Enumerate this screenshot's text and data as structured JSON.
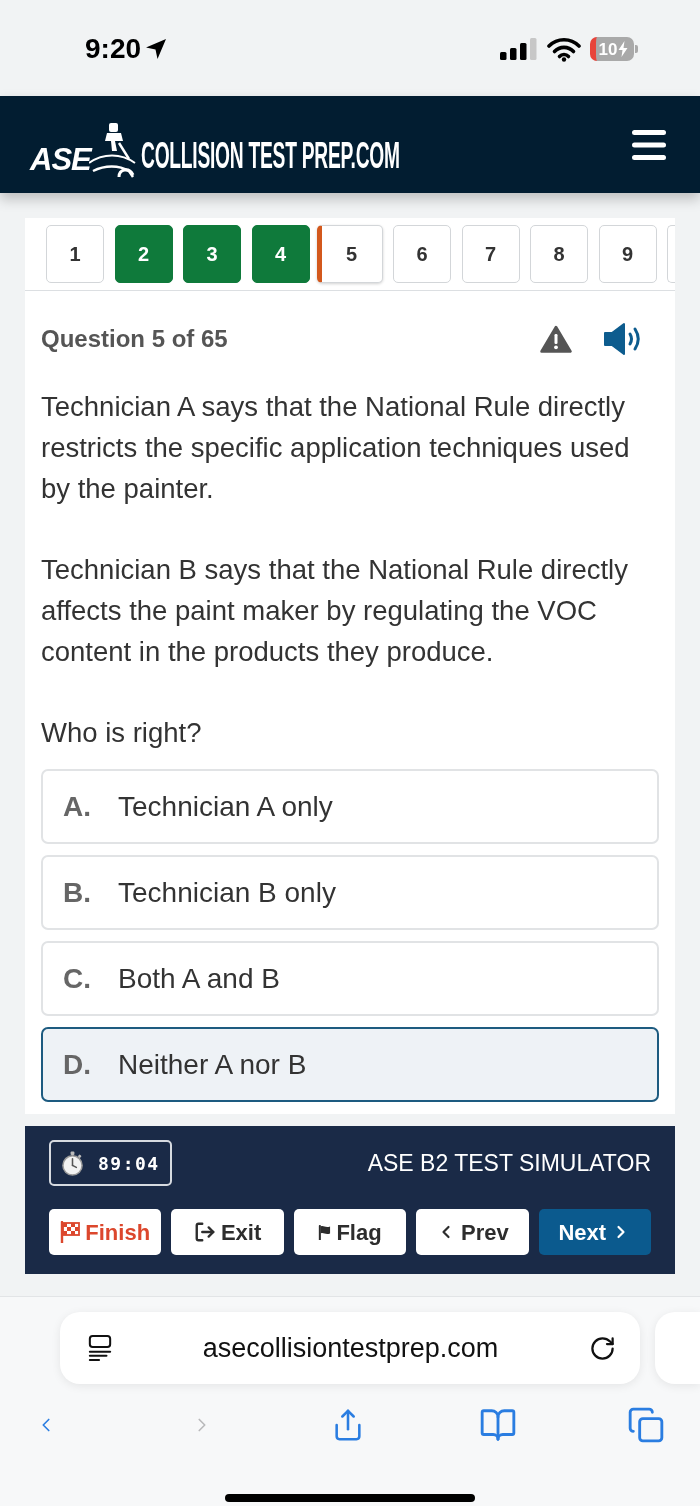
{
  "status_bar": {
    "time": "9:20",
    "battery": "10"
  },
  "header": {
    "logo_mark": "ASE",
    "logo_text": "COLLISION TEST PREP.COM"
  },
  "question_nav": [
    {
      "label": "1",
      "answered": false,
      "selected": false
    },
    {
      "label": "2",
      "answered": true,
      "selected": false
    },
    {
      "label": "3",
      "answered": true,
      "selected": false
    },
    {
      "label": "4",
      "answered": true,
      "selected": false
    },
    {
      "label": "5",
      "answered": false,
      "selected": true
    },
    {
      "label": "6",
      "answered": false,
      "selected": false
    },
    {
      "label": "7",
      "answered": false,
      "selected": false
    },
    {
      "label": "8",
      "answered": false,
      "selected": false
    },
    {
      "label": "9",
      "answered": false,
      "selected": false
    }
  ],
  "question": {
    "counter": "Question 5 of 65",
    "paragraphs": [
      "Technician A says that the National Rule directly restricts the specific application techniques used by the painter.",
      "Technician B says that the National Rule directly affects the paint maker by regulating the VOC content in the products they produce.",
      "Who is right?"
    ]
  },
  "options": [
    {
      "letter": "A.",
      "text": "Technician A only",
      "selected": false
    },
    {
      "letter": "B.",
      "text": "Technician B only",
      "selected": false
    },
    {
      "letter": "C.",
      "text": "Both A and B",
      "selected": false
    },
    {
      "letter": "D.",
      "text": "Neither A nor B",
      "selected": true
    }
  ],
  "footer": {
    "timer": "89:04",
    "title": "ASE B2 TEST SIMULATOR",
    "buttons": [
      {
        "kind": "finish",
        "label": "Finish"
      },
      {
        "kind": "exit",
        "label": "Exit"
      },
      {
        "kind": "flag",
        "label": "Flag"
      },
      {
        "kind": "prev",
        "label": "Prev"
      },
      {
        "kind": "next",
        "label": "Next"
      }
    ]
  },
  "browser": {
    "url": "asecollisiontestprep.com",
    "toolbar": [
      {
        "kind": "back",
        "disabled": false
      },
      {
        "kind": "forward",
        "disabled": true
      },
      {
        "kind": "share",
        "disabled": false
      },
      {
        "kind": "bookmarks",
        "disabled": false
      },
      {
        "kind": "tabs",
        "disabled": false
      }
    ]
  }
}
